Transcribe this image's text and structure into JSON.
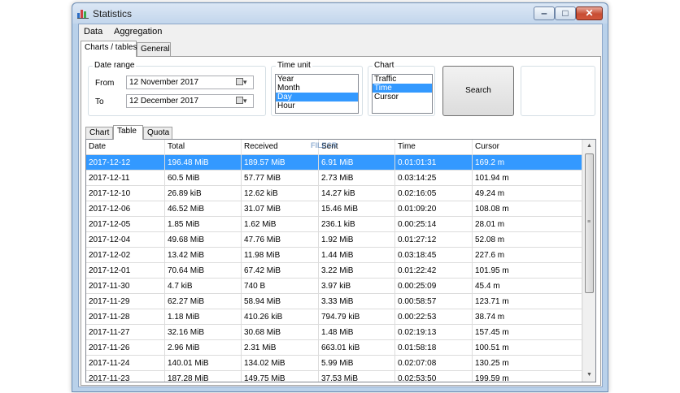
{
  "window": {
    "title": "Statistics",
    "min_label": "‒",
    "max_label": "□",
    "close_label": "✕"
  },
  "menu": [
    "Data",
    "Aggregation"
  ],
  "outer_tabs": [
    "Charts / tables",
    "General"
  ],
  "date_range": {
    "title": "Date range",
    "from_label": "From",
    "from_value": "12 November 2017",
    "to_label": "To",
    "to_value": "12 December 2017",
    "dropdown_glyph": "▾"
  },
  "time_unit": {
    "title": "Time unit",
    "options": [
      "Year",
      "Month",
      "Day",
      "Hour"
    ],
    "selected": "Day"
  },
  "chart_select": {
    "title": "Chart",
    "options": [
      "Traffic",
      "Time",
      "Cursor"
    ],
    "selected": "Time"
  },
  "search_label": "Search",
  "inner_tabs": [
    "Chart",
    "Table",
    "Quota"
  ],
  "watermark": "FILECR",
  "table": {
    "columns": [
      "Date",
      "Total",
      "Received",
      "Sent",
      "Time",
      "Cursor"
    ],
    "rows": [
      [
        "2017-12-12",
        "196.48 MiB",
        "189.57 MiB",
        "6.91 MiB",
        "0.01:01:31",
        "169.2 m"
      ],
      [
        "2017-12-11",
        "60.5 MiB",
        "57.77 MiB",
        "2.73 MiB",
        "0.03:14:25",
        "101.94 m"
      ],
      [
        "2017-12-10",
        "26.89 kiB",
        "12.62 kiB",
        "14.27 kiB",
        "0.02:16:05",
        "49.24 m"
      ],
      [
        "2017-12-06",
        "46.52 MiB",
        "31.07 MiB",
        "15.46 MiB",
        "0.01:09:20",
        "108.08 m"
      ],
      [
        "2017-12-05",
        "1.85 MiB",
        "1.62 MiB",
        "236.1 kiB",
        "0.00:25:14",
        "28.01 m"
      ],
      [
        "2017-12-04",
        "49.68 MiB",
        "47.76 MiB",
        "1.92 MiB",
        "0.01:27:12",
        "52.08 m"
      ],
      [
        "2017-12-02",
        "13.42 MiB",
        "11.98 MiB",
        "1.44 MiB",
        "0.03:18:45",
        "227.6 m"
      ],
      [
        "2017-12-01",
        "70.64 MiB",
        "67.42 MiB",
        "3.22 MiB",
        "0.01:22:42",
        "101.95 m"
      ],
      [
        "2017-11-30",
        "4.7 kiB",
        "740 B",
        "3.97 kiB",
        "0.00:25:09",
        "45.4 m"
      ],
      [
        "2017-11-29",
        "62.27 MiB",
        "58.94 MiB",
        "3.33 MiB",
        "0.00:58:57",
        "123.71 m"
      ],
      [
        "2017-11-28",
        "1.18 MiB",
        "410.26 kiB",
        "794.79 kiB",
        "0.00:22:53",
        "38.74 m"
      ],
      [
        "2017-11-27",
        "32.16 MiB",
        "30.68 MiB",
        "1.48 MiB",
        "0.02:19:13",
        "157.45 m"
      ],
      [
        "2017-11-26",
        "2.96 MiB",
        "2.31 MiB",
        "663.01 kiB",
        "0.01:58:18",
        "100.51 m"
      ],
      [
        "2017-11-24",
        "140.01 MiB",
        "134.02 MiB",
        "5.99 MiB",
        "0.02:07:08",
        "130.25 m"
      ],
      [
        "2017-11-23",
        "187.28 MiB",
        "149.75 MiB",
        "37.53 MiB",
        "0.02:53:50",
        "199.59 m"
      ]
    ],
    "selected_row": 0
  },
  "icons": {
    "app": "bar-chart-icon",
    "calendar": "calendar-icon"
  }
}
